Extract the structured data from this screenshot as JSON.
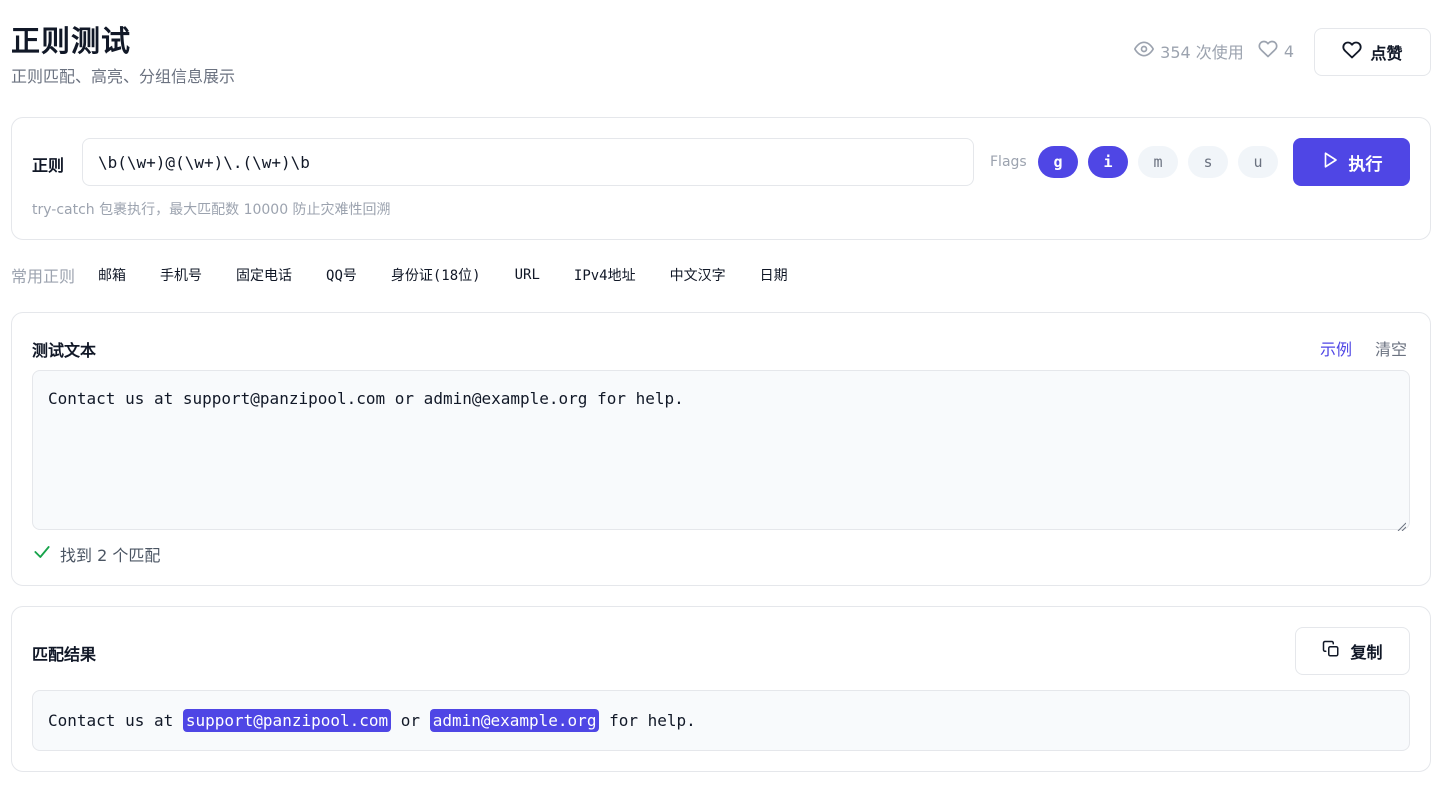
{
  "header": {
    "title": "正则测试",
    "subtitle": "正则匹配、高亮、分组信息展示",
    "usage_count": "354 次使用",
    "like_count": "4",
    "like_button_label": "点赞"
  },
  "regex": {
    "label": "正则",
    "pattern": "\\b(\\w+)@(\\w+)\\.(\\w+)\\b",
    "flags_label": "Flags",
    "flags": [
      {
        "name": "g",
        "active": true
      },
      {
        "name": "i",
        "active": true
      },
      {
        "name": "m",
        "active": false
      },
      {
        "name": "s",
        "active": false
      },
      {
        "name": "u",
        "active": false
      }
    ],
    "run_label": "执行",
    "hint": "try-catch 包裹执行，最大匹配数 10000 防止灾难性回溯"
  },
  "presets": {
    "label": "常用正则",
    "items": [
      "邮箱",
      "手机号",
      "固定电话",
      "QQ号",
      "身份证(18位)",
      "URL",
      "IPv4地址",
      "中文汉字",
      "日期"
    ]
  },
  "test": {
    "title": "测试文本",
    "example_label": "示例",
    "clear_label": "清空",
    "text": "Contact us at support@panzipool.com or admin@example.org for help.",
    "status": "找到 2 个匹配"
  },
  "result": {
    "title": "匹配结果",
    "copy_label": "复制",
    "segments": [
      {
        "text": "Contact us at ",
        "match": false
      },
      {
        "text": "support@panzipool.com",
        "match": true
      },
      {
        "text": " or ",
        "match": false
      },
      {
        "text": "admin@example.org",
        "match": true
      },
      {
        "text": " for help.",
        "match": false
      }
    ]
  },
  "colors": {
    "accent": "#4f46e5",
    "success": "#16a34a"
  }
}
